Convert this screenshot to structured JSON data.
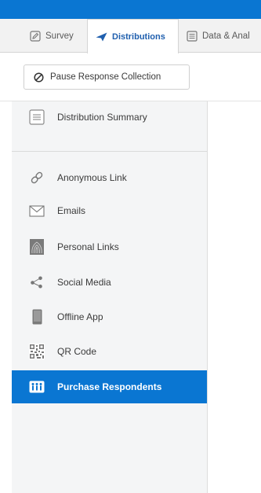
{
  "tabs": [
    {
      "label": "Survey",
      "icon": "pencil-icon"
    },
    {
      "label": "Distributions",
      "icon": "paper-plane-icon",
      "active": true
    },
    {
      "label": "Data & Anal",
      "icon": "list-icon"
    }
  ],
  "pause_button": {
    "label": "Pause Response Collection",
    "icon": "circle-slash-icon"
  },
  "sidebar": {
    "summary": {
      "label": "Distribution Summary",
      "icon": "summary-icon"
    },
    "items": [
      {
        "label": "Anonymous Link",
        "icon": "link-icon"
      },
      {
        "label": "Emails",
        "icon": "envelope-icon"
      },
      {
        "label": "Personal Links",
        "icon": "fingerprint-icon"
      },
      {
        "label": "Social Media",
        "icon": "share-icon"
      },
      {
        "label": "Offline App",
        "icon": "tablet-icon"
      },
      {
        "label": "QR Code",
        "icon": "qr-code-icon"
      },
      {
        "label": "Purchase Respondents",
        "icon": "people-icon",
        "active": true
      }
    ]
  },
  "colors": {
    "accent": "#0a76d2",
    "active_tab_text": "#1f5fae",
    "sidebar_bg": "#f4f5f6"
  }
}
